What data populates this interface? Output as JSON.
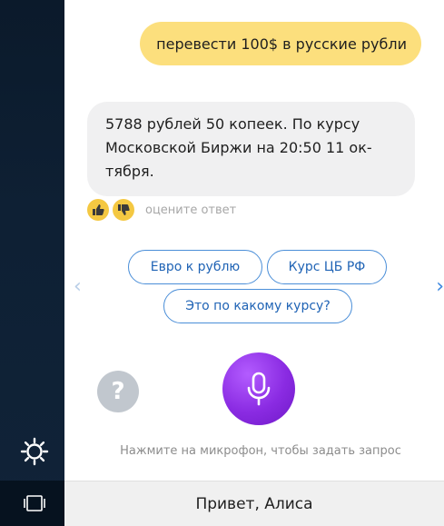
{
  "conversation": {
    "user_message": "перевести 100$ в русские рубли",
    "assistant_message": "5788 рублей 50 копеек. По курсу Московской Биржи на 20:50 11 ок-тября."
  },
  "rating": {
    "label": "оцените ответ",
    "like_icon": "thumbs-up-icon",
    "dislike_icon": "thumbs-down-icon"
  },
  "suggestions": [
    {
      "label": "Евро к рублю"
    },
    {
      "label": "Курс ЦБ РФ"
    },
    {
      "label": "Это по какому курсу?"
    }
  ],
  "controls": {
    "help_symbol": "?",
    "hint": "Нажмите на микрофон, чтобы задать запрос"
  },
  "bottom_bar": {
    "title": "Привет, Алиса"
  },
  "colors": {
    "user_bubble": "#fcdf7d",
    "assistant_bubble": "#f0f0f1",
    "accent": "#4a8ed8",
    "mic": "#8a2be2",
    "sidebar": "#0e2034"
  }
}
